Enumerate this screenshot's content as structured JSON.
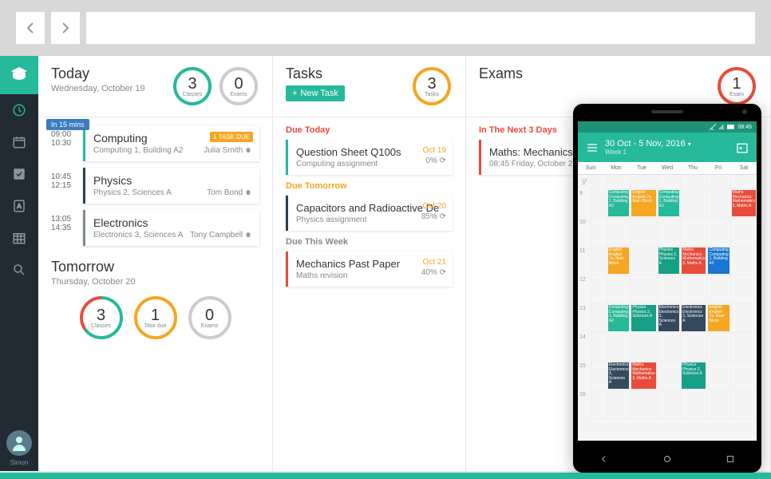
{
  "chrome": {
    "back": "‹",
    "forward": "›"
  },
  "sidebar": {
    "username": "Simon"
  },
  "today": {
    "title": "Today",
    "subtitle": "Wednesday, October 19",
    "rings": [
      {
        "num": "3",
        "label": "Classes",
        "color": "#26b99a",
        "pct": 100
      },
      {
        "num": "0",
        "label": "Exams",
        "color": "#ccc",
        "pct": 100
      }
    ],
    "time_pill": "In 15 mins",
    "classes": [
      {
        "start": "09:00",
        "end": "10:30",
        "name": "Computing",
        "location": "Computing 1, Building A2",
        "teacher": "Julia Smith",
        "badge": "1 TASK DUE",
        "color": "#26b99a"
      },
      {
        "start": "10:45",
        "end": "12:15",
        "name": "Physics",
        "location": "Physics 2, Sciences A",
        "teacher": "Tom Bond",
        "badge": "",
        "color": "#2c3e50"
      },
      {
        "start": "13:05",
        "end": "14:35",
        "name": "Electronics",
        "location": "Electronics 3, Sciences A",
        "teacher": "Tony Campbell",
        "badge": "",
        "color": "#7f8c8d"
      }
    ]
  },
  "tomorrow": {
    "title": "Tomorrow",
    "subtitle": "Thursday, October 20",
    "rings": [
      {
        "num": "3",
        "label": "Classes",
        "color_a": "#26b99a",
        "color_b": "#e74c3c"
      },
      {
        "num": "1",
        "label": "Task due",
        "color": "#f5a623"
      },
      {
        "num": "0",
        "label": "Exams",
        "color": "#ccc"
      }
    ]
  },
  "tasks": {
    "title": "Tasks",
    "new_btn": "New Task",
    "ring": {
      "num": "3",
      "label": "Tasks",
      "color": "#f5a623"
    },
    "groups": [
      {
        "label": "Due Today",
        "cls": "lbl-today",
        "items": [
          {
            "title": "Question Sheet Q100s",
            "sub": "Computing assignment",
            "date": "Oct 19",
            "pct": "0% ⟳",
            "color": "#26b99a"
          }
        ]
      },
      {
        "label": "Due Tomorrow",
        "cls": "lbl-tomorrow",
        "items": [
          {
            "title": "Capacitors and Radioactive De",
            "sub": "Physics assignment",
            "date": "Oct 20",
            "pct": "85% ⟳",
            "color": "#2c3e50"
          }
        ]
      },
      {
        "label": "Due This Week",
        "cls": "lbl-week",
        "items": [
          {
            "title": "Mechanics Past Paper",
            "sub": "Maths revision",
            "date": "Oct 21",
            "pct": "40% ⟳",
            "color": "#e74c3c"
          }
        ]
      }
    ]
  },
  "exams": {
    "title": "Exams",
    "ring": {
      "num": "1",
      "label": "Exam",
      "color": "#e74c3c"
    },
    "label": "In The Next 3 Days",
    "items": [
      {
        "title": "Maths: Mechanics",
        "sub": "08:45 Friday, October 21",
        "color": "#e74c3c"
      }
    ]
  },
  "phone": {
    "time": "08:45",
    "title": "30 Oct - 5 Nov, 2016",
    "subtitle": "Week 1",
    "days": [
      "Sun",
      "Mon",
      "Tue",
      "Wed",
      "Thu",
      "Fri",
      "Sat"
    ],
    "hours": [
      "9",
      "10",
      "11",
      "12",
      "13",
      "14",
      "15",
      "16"
    ],
    "blocks": {
      "Mon": [
        {
          "h": 9,
          "txt": "Computing Computing 1, Building A2",
          "c": "c-teal"
        },
        {
          "h": 11,
          "txt": "English English 7a, Main Block",
          "c": "c-orange"
        },
        {
          "h": 13,
          "txt": "Computing Computing 1, Building A2",
          "c": "c-teal"
        },
        {
          "h": 15,
          "txt": "Electronics Electronics 3, Sciences A",
          "c": "c-navy"
        }
      ],
      "Tue": [
        {
          "h": 9,
          "txt": "English English 7a, Main Block",
          "c": "c-orange"
        },
        {
          "h": 13,
          "txt": "Physics Physics 2, Sciences A",
          "c": "c-green"
        },
        {
          "h": 15,
          "txt": "Maths: Mechanics Mathematics 3, Maths A",
          "c": "c-red"
        }
      ],
      "Wed": [
        {
          "h": 9,
          "txt": "Computing Computing 1, Building A2",
          "c": "c-teal"
        },
        {
          "h": 11,
          "txt": "Physics Physics 2, Sciences A",
          "c": "c-green"
        },
        {
          "h": 13,
          "txt": "Electronics Electronics 3, Sciences A",
          "c": "c-navy"
        }
      ],
      "Thu": [
        {
          "h": 11,
          "txt": "Maths: Mechanics Mathematics 3, Maths A",
          "c": "c-red"
        },
        {
          "h": 13,
          "txt": "Electronics Electronics 3, Sciences A",
          "c": "c-navy"
        },
        {
          "h": 15,
          "txt": "Physics Physics 2, Sciences A",
          "c": "c-green"
        }
      ],
      "Fri": [
        {
          "h": 11,
          "txt": "Computing Computing 1, Building A2",
          "c": "c-blue"
        },
        {
          "h": 13,
          "txt": "English English 7a, Main Block",
          "c": "c-orange"
        }
      ],
      "Sat": [
        {
          "h": 9,
          "txt": "Maths: Mechanics Mathematics 3, Maths A",
          "c": "c-red"
        }
      ]
    }
  }
}
